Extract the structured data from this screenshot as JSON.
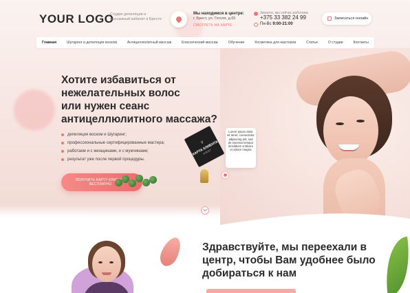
{
  "header": {
    "logo": "YOUR LOGO",
    "tagline": "Студия депиляции и массажный кабинет в Бресте",
    "address_title": "Мы находимся в центре:",
    "address": "г. Брест, ул. Гоголя, д.65",
    "map_link": "СМОТРЕТЬ НА КАРТЕ",
    "phone_note": "Звоните, мы сейчас работаем",
    "phone": "+375 33 382 24 99",
    "hours_days": "Пн-Вс",
    "hours_time": "9:00-21:00",
    "signup_button": "Записаться онлайн"
  },
  "nav": {
    "items": [
      "Главная",
      "Шугаринг и депиляция воском",
      "Антицеллюлитный массаж",
      "Классический массаж",
      "Обучение",
      "Косметика для мастеров",
      "Статьи",
      "О студии",
      "Контакты"
    ]
  },
  "hero": {
    "title_line1": "Хотите избавиться от",
    "title_line2": "нежелательных волос",
    "title_line3": "или нужен сеанс",
    "title_line4": "антицеллюлитного массажа?",
    "features": [
      "депиляция воском и Шугаринг;",
      "профессиональные сертифицированные мастера;",
      "работаем и с женщинами, и с мужчинами;",
      "результат уже после первой процедуры."
    ],
    "cta": "ПОЛУЧИТЬ КАРТУ КЛИЕНТА БЕСПЛАТНО",
    "card_logo": "♆",
    "card_title": "КАРТА КЛИЕНТА",
    "card_sub": "Я ВСЕТ",
    "callout": "Lorem ipsum dolor sit amet, consectetur adipiscing elit, sed do eiusmod tempor incididunt ut labore et dolore magna"
  },
  "section2": {
    "title": "Здравствуйте, мы переехали в центр, чтобы Вам удобнее было добираться к нам"
  },
  "colors": {
    "accent": "#f07474",
    "text": "#2b2b2b"
  }
}
